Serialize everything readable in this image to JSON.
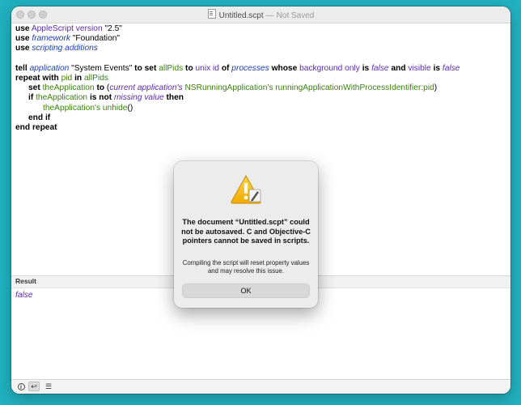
{
  "window": {
    "title": "Untitled.scpt",
    "separator": "—",
    "status": "Not Saved"
  },
  "editor": {
    "l1": {
      "kw1": "use",
      "t1": "AppleScript version",
      "s1": "\"2.5\""
    },
    "l2": {
      "kw1": "use",
      "t1": "framework",
      "s1": "\"Foundation\""
    },
    "l3": {
      "kw1": "use",
      "t1": "scripting additions"
    },
    "l5": {
      "kw1": "tell",
      "t1": "application",
      "s1": "\"System Events\"",
      "kw2": "to set",
      "v1": "allPids",
      "kw3": "to",
      "t2": "unix id",
      "kw4": "of",
      "t3": "processes",
      "kw5": "whose",
      "t4": "background only",
      "kw6": "is",
      "t5": "false",
      "kw7": "and",
      "t6": "visible",
      "kw8": "is",
      "t7": "false"
    },
    "l6": {
      "kw1": "repeat with",
      "v1": "pid",
      "kw2": "in",
      "v2": "allPids"
    },
    "l7": {
      "kw1": "set",
      "v1": "theApplication",
      "kw2": "to",
      "p1": "(",
      "t1": "current application's",
      "v2": "NSRunningApplication's runningApplicationWithProcessIdentifier:",
      "v3": "pid",
      "p2": ")"
    },
    "l8": {
      "kw1": "if",
      "v1": "theApplication",
      "kw2": "is not",
      "t1": "missing value",
      "kw3": "then"
    },
    "l9": {
      "v1": "theApplication's unhide",
      "p1": "()"
    },
    "l10": {
      "kw1": "end if"
    },
    "l11": {
      "kw1": "end repeat"
    }
  },
  "result": {
    "header": "Result",
    "value": "false"
  },
  "bottombar": {
    "btn_info": "i",
    "btn_reply": "↩",
    "btn_list": "☰"
  },
  "dialog": {
    "heading": "The document “Untitled.scpt” could not be autosaved. C and Objective-C pointers cannot be saved in scripts.",
    "info": "Compiling the script will reset property values and may resolve this issue.",
    "ok_label": "OK"
  },
  "colors": {
    "desktop": "#21b1c0",
    "application_class": "#5b2ca0",
    "terminology": "#1c3fa6",
    "variable": "#3a7f0f"
  }
}
